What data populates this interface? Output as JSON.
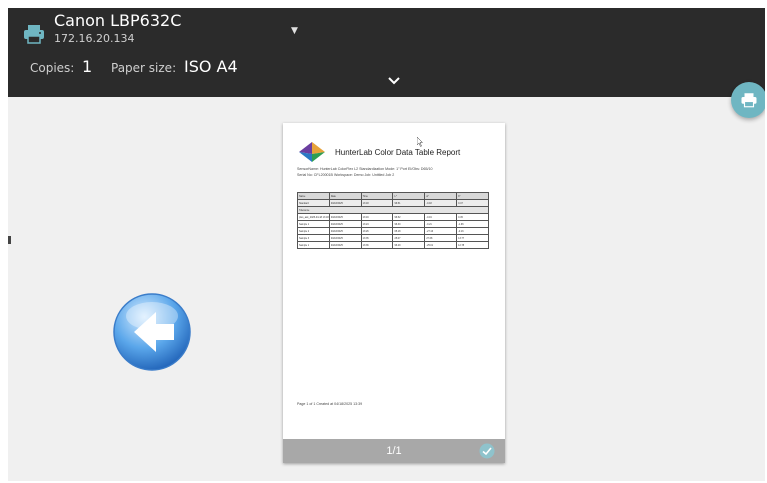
{
  "printer": {
    "name": "Canon LBP632C",
    "ip": "172.16.20.134",
    "icon": "printer-icon",
    "dropdown_icon": "caret-down-icon"
  },
  "settings": {
    "copies_label": "Copies:",
    "copies_value": "1",
    "paper_label": "Paper size:",
    "paper_value": "ISO A4",
    "expand_icon": "chevron-down-icon"
  },
  "actions": {
    "print_icon": "print-icon",
    "back_icon": "back-arrow-icon"
  },
  "colors": {
    "header_bg": "#2b2b2b",
    "accent": "#6fb6c2",
    "preview_bg": "#f0f0f0",
    "page_bar": "#a8a8a8"
  },
  "preview": {
    "title": "HunterLab Color Data Table Report",
    "info_line1": "SensorName: HunterLab ColorFlex L2    Standardization Mode: 1\" Port    EI/Obs: D65/10",
    "info_line2": "Serial No: CFL20001B    Workspace: Demo    Job: Untitled Job 2",
    "table": {
      "headers": [
        "Name",
        "Date",
        "Time",
        "L*",
        "a*",
        "b*"
      ],
      "rows": [
        [
          "Standard",
          "04/18/2025",
          "13:18",
          "96.51",
          "-0.18",
          "0.47"
        ],
        [
          "Tolerance",
          "",
          "",
          "",
          "",
          ""
        ],
        [
          "plus_ask_2025-04-18 13:18:21",
          "04/18/2025",
          "13:19",
          "96.52",
          "-0.19",
          "0.45"
        ],
        [
          "Sample 1",
          "04/18/2025",
          "13:24",
          "96.30",
          "-0.21",
          "-1.96"
        ],
        [
          "Sample 2",
          "04/18/2025",
          "13:26",
          "65.18",
          "-27.16",
          "-0.16"
        ],
        [
          "Sample 3",
          "04/18/2025",
          "13:35",
          "25.07",
          "27.68",
          "13.77"
        ],
        [
          "Sample 1",
          "04/18/2025",
          "13:36",
          "96.29",
          "-25.01",
          "12.78"
        ]
      ]
    },
    "footer": "Page 1 of 1    Created at 04/18/2025 13:39",
    "page_counter": "1/1",
    "check_icon": "check-circle-icon"
  }
}
